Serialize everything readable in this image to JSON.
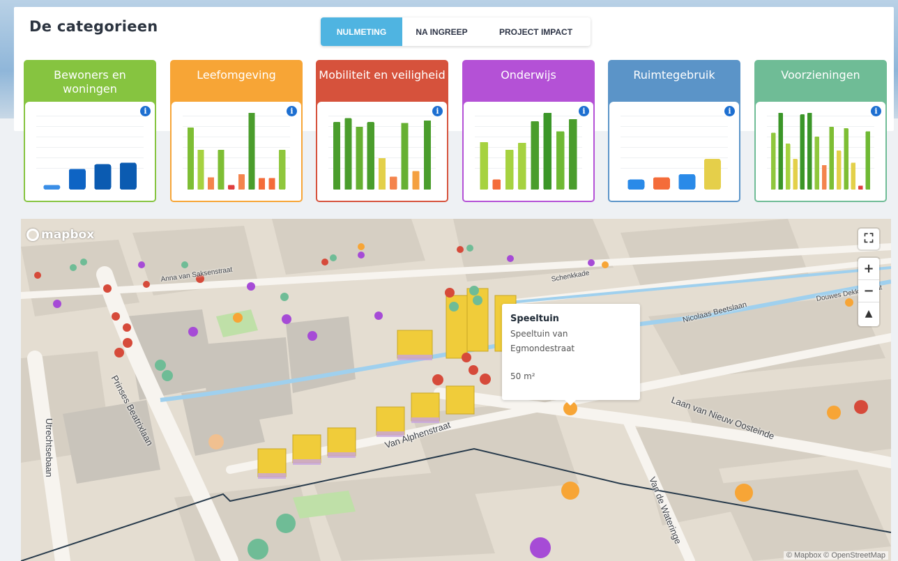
{
  "header": {
    "title": "De categorieen"
  },
  "tabs": [
    {
      "label": "NULMETING",
      "active": true
    },
    {
      "label": "NA INGREEP",
      "active": false
    },
    {
      "label": "PROJECT IMPACT",
      "active": false
    }
  ],
  "categories": [
    {
      "title": "Bewoners en woningen",
      "color": "#86c440",
      "chart_data": {
        "type": "bar",
        "values": [
          0.06,
          0.27,
          0.33,
          0.35
        ],
        "colors": [
          "#3a8ee6",
          "#0e64c4",
          "#0b5bb1",
          "#0b5bb1"
        ]
      }
    },
    {
      "title": "Leefomgeving",
      "color": "#f7a536",
      "chart_data": {
        "type": "bar",
        "values": [
          0.81,
          0.52,
          0.16,
          0.52,
          0.06,
          0.2,
          1.0,
          0.15,
          0.15,
          0.52
        ],
        "colors": [
          "#7ebe34",
          "#a6d240",
          "#f4844d",
          "#7ebe34",
          "#e03e3e",
          "#f4844d",
          "#4a9d2c",
          "#f46c3a",
          "#f46c3a",
          "#8fc73d"
        ]
      }
    },
    {
      "title": "Mobiliteit en veiligheid",
      "color": "#d6523c",
      "chart_data": {
        "type": "bar",
        "values": [
          0.88,
          0.93,
          0.82,
          0.88,
          0.41,
          0.17,
          0.87,
          0.24,
          0.9
        ],
        "colors": [
          "#4a9d2c",
          "#4a9d2c",
          "#66b032",
          "#4a9d2c",
          "#e3d04a",
          "#f4844d",
          "#66b032",
          "#f4a040",
          "#4a9d2c"
        ]
      }
    },
    {
      "title": "Onderwijs",
      "color": "#b451d6",
      "chart_data": {
        "type": "bar",
        "values": [
          0.62,
          0.13,
          0.52,
          0.61,
          0.89,
          1.0,
          0.76,
          0.92
        ],
        "colors": [
          "#a6d240",
          "#f46c3a",
          "#a6d240",
          "#a6d240",
          "#4a9d2c",
          "#3b9628",
          "#6fb934",
          "#4a9d2c"
        ]
      }
    },
    {
      "title": "Ruimtegebruik",
      "color": "#5b94c8",
      "chart_data": {
        "type": "bar",
        "values": [
          0.13,
          0.16,
          0.2,
          0.4
        ],
        "colors": [
          "#2a8ae8",
          "#f46c3a",
          "#2a8ae8",
          "#e5cf4a"
        ]
      }
    },
    {
      "title": "Voorzieningen",
      "color": "#6fbc96",
      "chart_data": {
        "type": "bar",
        "values": [
          0.74,
          1.0,
          0.6,
          0.4,
          0.98,
          1.0,
          0.69,
          0.32,
          0.82,
          0.51,
          0.8,
          0.35,
          0.05,
          0.76
        ],
        "colors": [
          "#8fc73d",
          "#3b9628",
          "#a6d240",
          "#e3d04a",
          "#3b9628",
          "#3b9628",
          "#8fc73d",
          "#f4844d",
          "#7ebe34",
          "#e3d04a",
          "#7ebe34",
          "#e3d04a",
          "#e03e3e",
          "#6fb934"
        ]
      }
    }
  ],
  "map": {
    "logo": "mapbox",
    "controls": {
      "fullscreen": "⛶",
      "zoom_in": "+",
      "zoom_out": "−",
      "compass": "▲"
    },
    "popup": {
      "title": "Speeltuin",
      "subtitle": "Speeltuin van Egmondestraat",
      "area": "50 m²"
    },
    "streets": [
      "Prinses Beatrixlaan",
      "Utrechtsebaan",
      "Laan van Nieuw Oosteinde",
      "Van Alphenstraat",
      "Van de Wateringe",
      "Nicolaas Beetslaan",
      "Schenkkade",
      "Douwes Dekkerstraat",
      "Anna van Saksenstraat"
    ],
    "attribution": "© Mapbox © OpenStreetMap"
  }
}
